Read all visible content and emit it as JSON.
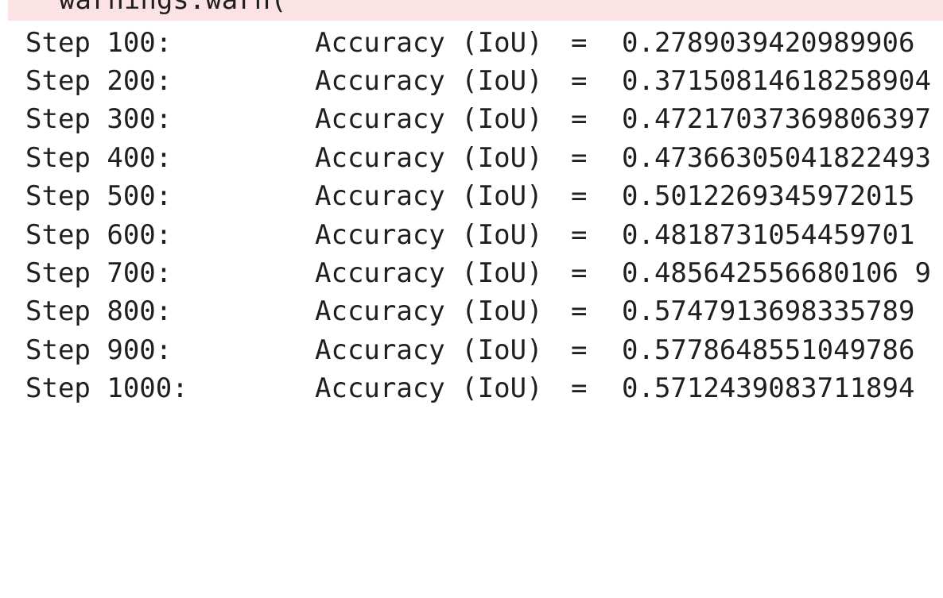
{
  "stderr": {
    "line": "warnings.warn("
  },
  "output": {
    "metric_label": "Accuracy (IoU)",
    "equals": "=",
    "rows": [
      {
        "step": "Step 100:",
        "value": "0.2789039420989906"
      },
      {
        "step": "Step 200:",
        "value": "0.37150814618258904"
      },
      {
        "step": "Step 300:",
        "value": "0.47217037369806397"
      },
      {
        "step": "Step 400:",
        "value": "0.47366305041822493"
      },
      {
        "step": "Step 500:",
        "value": "0.5012269345972015"
      },
      {
        "step": "Step 600:",
        "value": "0.4818731054459701"
      },
      {
        "step": "Step 700:",
        "value": "0.485642556680106 9"
      },
      {
        "step": "Step 800:",
        "value": "0.5747913698335789"
      },
      {
        "step": "Step 900:",
        "value": "0.5778648551049786"
      },
      {
        "step": "Step 1000:",
        "value": "0.5712439083711894"
      }
    ]
  },
  "colors": {
    "stderr_background": "#fbe3e5",
    "text": "#1f1f1f",
    "page_background": "#ffffff"
  }
}
